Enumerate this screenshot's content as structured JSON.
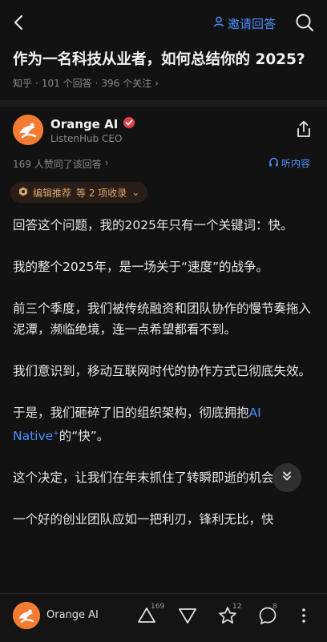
{
  "header": {
    "invite_label": "邀请回答",
    "icons": [
      "back-icon",
      "person-icon",
      "search-icon"
    ]
  },
  "question": {
    "title": "作为一名科技从业者，如何总结你的 2025?",
    "source": "知乎",
    "sep1": "·",
    "answers": "101 个回答",
    "sep2": "·",
    "followers": "396 个关注",
    "chevron": "›"
  },
  "author": {
    "name": "Orange AI",
    "description": "ListenHub CEO"
  },
  "stats": {
    "likes": "169 人赞同了该回答",
    "chevron": "›",
    "listen_label": "听内容"
  },
  "badge": {
    "label": "编辑推荐",
    "extra": "等 2 项收录",
    "chevron": "⌄"
  },
  "content": {
    "p1": "回答这个问题，我的2025年只有一个关键词：快。",
    "p2": "我的整个2025年，是一场关于“速度”的战争。",
    "p3": "前三个季度，我们被传统融资和团队协作的慢节奏拖入泥潭，濒临绝境，连一点希望都看不到。",
    "p4": "我们意识到，移动互联网时代的协作方式已彻底失效。",
    "p5_pre": "于是，我们砸碎了旧的组织架构，彻底拥抱",
    "p5_link": "AI Native",
    "p5_sup": "+",
    "p5_post": "的“快”。",
    "p6": "这个决定，让我们在年末抓住了转瞬即逝的机会。",
    "p7": "一个好的创业团队应如一把利刃，锋利无比，快"
  },
  "bottom_bar": {
    "name": "Orange AI",
    "upvote_count": "169",
    "favorite_count": "12",
    "comment_count": "8"
  },
  "colors": {
    "background": "#121212",
    "accent_blue": "#4a90ff",
    "avatar_orange": "#f47b31",
    "badge_gold": "#d9a36d"
  }
}
